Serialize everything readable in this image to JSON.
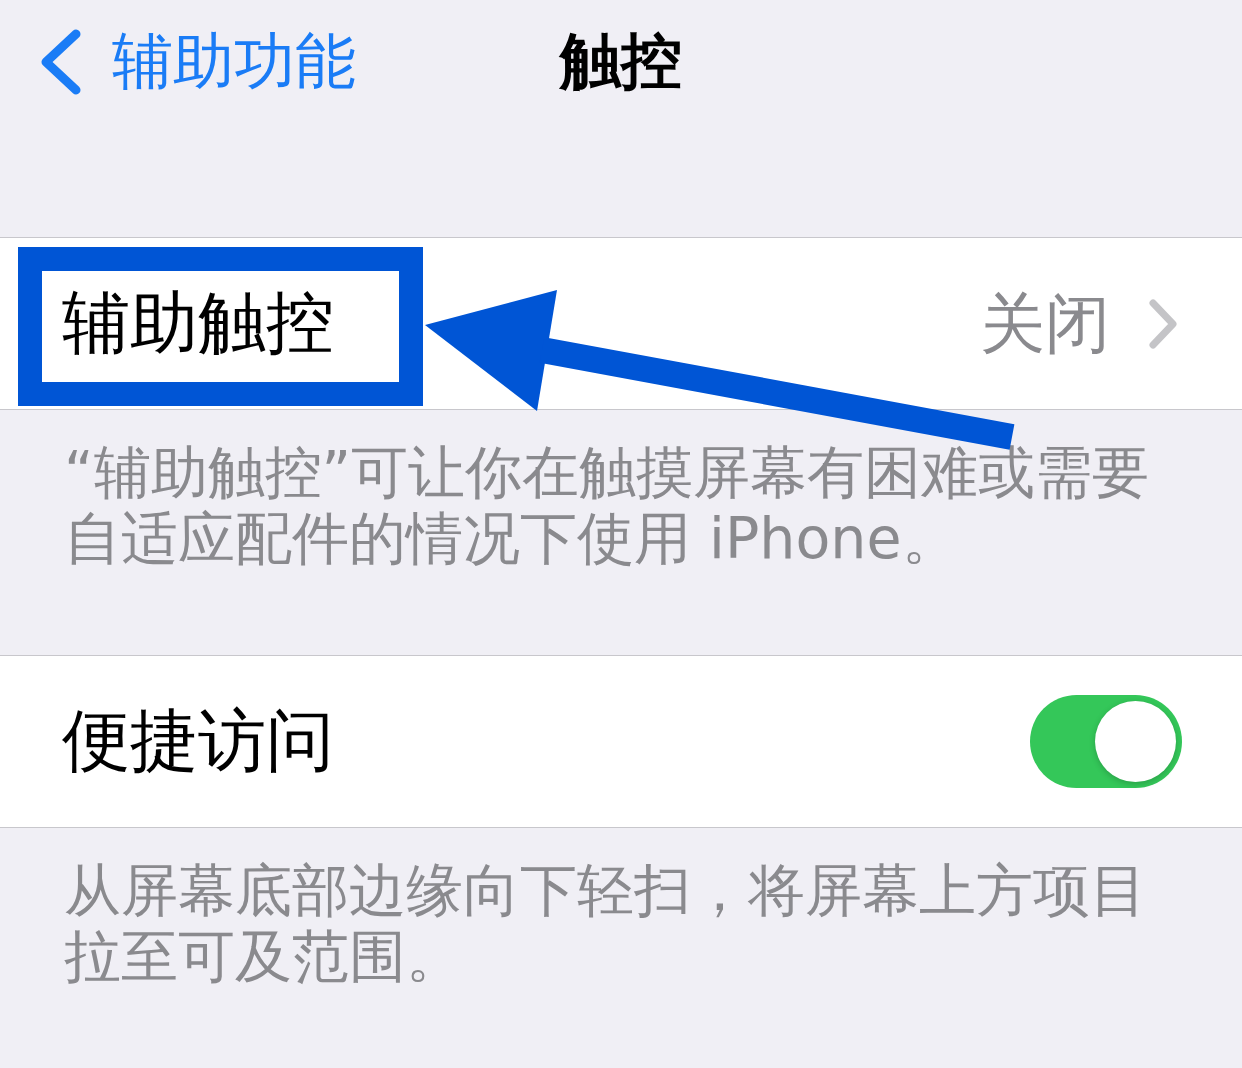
{
  "nav": {
    "back_label": "辅助功能",
    "title": "触控"
  },
  "groups": [
    {
      "rows": [
        {
          "kind": "disclosure",
          "label": "辅助触控",
          "value": "关闭",
          "annotated": true
        }
      ],
      "footer": "“辅助触控”可让你在触摸屏幕有困难或需要自适应配件的情况下使用 iPhone。"
    },
    {
      "rows": [
        {
          "kind": "toggle",
          "label": "便捷访问",
          "on": true,
          "annotated": false
        }
      ],
      "footer": "从屏幕底部边缘向下轻扫，将屏幕上方项目拉至可及范围。"
    }
  ]
}
